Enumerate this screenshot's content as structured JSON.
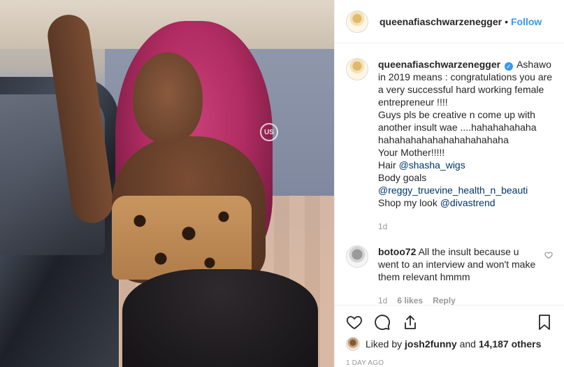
{
  "post": {
    "author": "queenafiaschwarzenegger",
    "follow_label": "Follow",
    "separator": "•",
    "watermark": "US"
  },
  "caption": {
    "username": "queenafiaschwarzenegger",
    "verified_mark": "✓",
    "lines": [
      "Ashawo in 2019 means : congratulations you are a very successful hard working female entrepreneur !!!!",
      "Guys pls be creative n come up with another insult wae ....hahahahahaha hahahahahahahahahahahaha",
      "Your Mother!!!!!"
    ],
    "hair_label": "Hair",
    "hair_mention": "@shasha_wigs",
    "body_label": "Body goals",
    "body_mention": "@reggy_truevine_health_n_beauti",
    "shop_label": "Shop my look",
    "shop_mention": "@divastrend",
    "age": "1d"
  },
  "reply": {
    "username": "botoo72",
    "text": "All the insult because u went to an interview and won't make them relevant hmmm",
    "age": "1d",
    "likes": "6 likes",
    "reply_label": "Reply"
  },
  "actions": {
    "like_icon": "heart-icon",
    "comment_icon": "comment-icon",
    "share_icon": "share-icon",
    "save_icon": "bookmark-icon"
  },
  "likes": {
    "prefix": "Liked by",
    "user": "josh2funny",
    "conj": "and",
    "count": "14,187 others"
  },
  "timestamp": "1 DAY AGO",
  "colors": {
    "link": "#3897f0",
    "mention": "#003569",
    "muted": "#999999"
  }
}
